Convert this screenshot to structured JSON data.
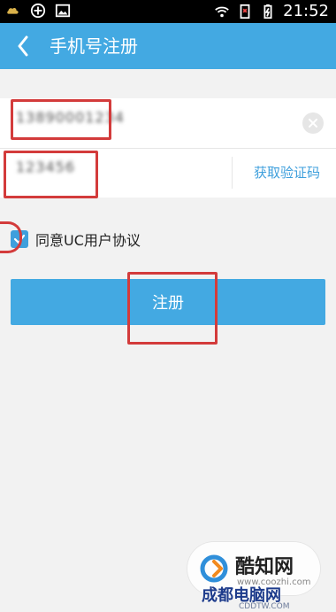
{
  "status_bar": {
    "time": "21:52",
    "left_icons": [
      "cloud-icon",
      "settings-sync-icon",
      "image-icon"
    ],
    "right_icons": [
      "wifi-icon",
      "sim-icon",
      "battery-charging-icon"
    ]
  },
  "app_bar": {
    "title": "手机号注册",
    "back_icon": "chevron-left-icon",
    "bg_color": "#43a9e2"
  },
  "form": {
    "phone": {
      "value": "13890001234"
    },
    "code": {
      "value": "123456"
    },
    "get_code_label": "获取验证码"
  },
  "agreement": {
    "checked": true,
    "label": "同意UC用户协议"
  },
  "primary_button": {
    "label": "注册"
  },
  "watermarks": {
    "brand": "酷知网",
    "brand_url": "www.coozhi.com",
    "site": "成都电脑网",
    "site_url": "CDDTW.COM"
  },
  "colors": {
    "accent": "#43a9e2",
    "link": "#3e9fdc",
    "annotation": "#d33b3b"
  }
}
